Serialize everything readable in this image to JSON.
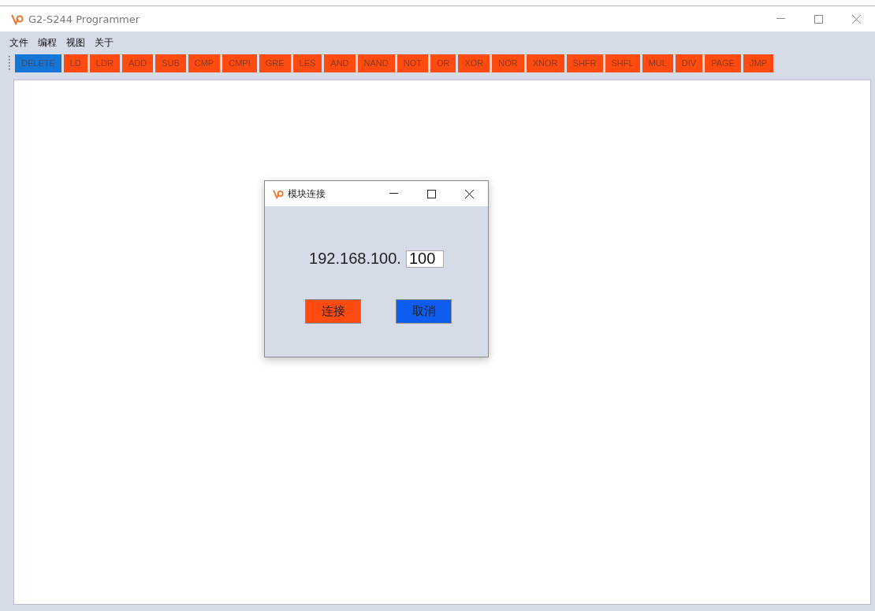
{
  "window": {
    "title": "G2-S244 Programmer"
  },
  "menu": [
    "文件",
    "编程",
    "视图",
    "关于"
  ],
  "toolbar": [
    {
      "label": "DELETE",
      "selected": true
    },
    {
      "label": "LD",
      "selected": false
    },
    {
      "label": "LDR",
      "selected": false
    },
    {
      "label": "ADD",
      "selected": false
    },
    {
      "label": "SUB",
      "selected": false
    },
    {
      "label": "CMP",
      "selected": false
    },
    {
      "label": "CMPI",
      "selected": false
    },
    {
      "label": "GRE",
      "selected": false
    },
    {
      "label": "LES",
      "selected": false
    },
    {
      "label": "AND",
      "selected": false
    },
    {
      "label": "NAND",
      "selected": false
    },
    {
      "label": "NOT",
      "selected": false
    },
    {
      "label": "OR",
      "selected": false
    },
    {
      "label": "XOR",
      "selected": false
    },
    {
      "label": "NOR",
      "selected": false
    },
    {
      "label": "XNOR",
      "selected": false
    },
    {
      "label": "SHFR",
      "selected": false
    },
    {
      "label": "SHFL",
      "selected": false
    },
    {
      "label": "MUL",
      "selected": false
    },
    {
      "label": "DIV",
      "selected": false
    },
    {
      "label": "PAGE",
      "selected": false
    },
    {
      "label": "JMP",
      "selected": false
    }
  ],
  "dialog": {
    "title": "模块连接",
    "ip_prefix": "192.168.100.",
    "ip_last": "100",
    "buttons": [
      {
        "label": "连接",
        "kind": "primary"
      },
      {
        "label": "取消",
        "kind": "secondary"
      }
    ]
  }
}
